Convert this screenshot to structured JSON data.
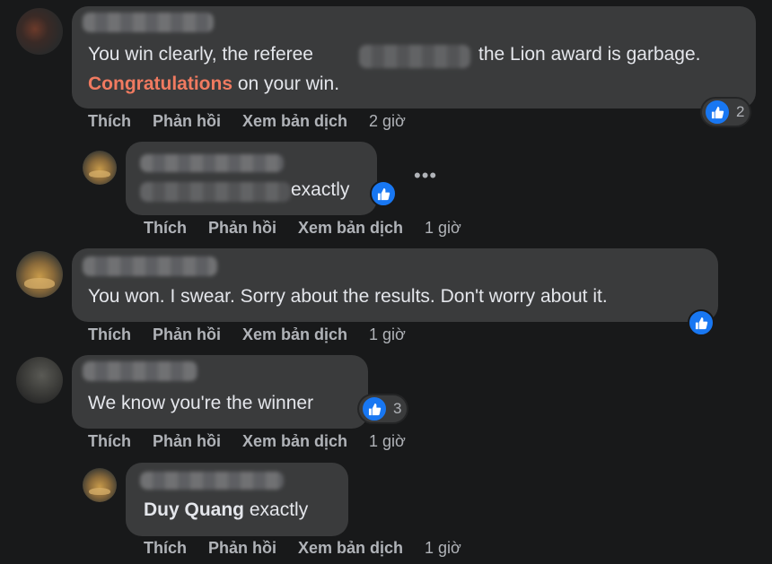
{
  "actions": {
    "like": "Thích",
    "reply": "Phản hồi",
    "translate": "Xem bản dịch"
  },
  "comments": [
    {
      "line1": "You win clearly, the referee",
      "line1_end": "the Lion award is garbage.",
      "highlight": "Congratulations",
      "line2_rest": " on your win.",
      "time": "2 giờ",
      "reactions": "2"
    },
    {
      "text_end": "exactly",
      "time": "1 giờ"
    },
    {
      "text": "You won. I swear. Sorry about the results. Don't worry about it.",
      "time": "1 giờ"
    },
    {
      "text": "We know you're the winner",
      "time": "1 giờ",
      "reactions": "3"
    },
    {
      "mention": "Duy Quang",
      "text": " exactly",
      "time": "1 giờ"
    }
  ],
  "icons": {
    "like_reaction": "thumbs-up-icon",
    "more_options": "more-options-icon"
  },
  "colors": {
    "background": "#18191a",
    "bubble": "#3a3b3c",
    "accent": "#f07a60",
    "like_blue": "#1877f2"
  }
}
